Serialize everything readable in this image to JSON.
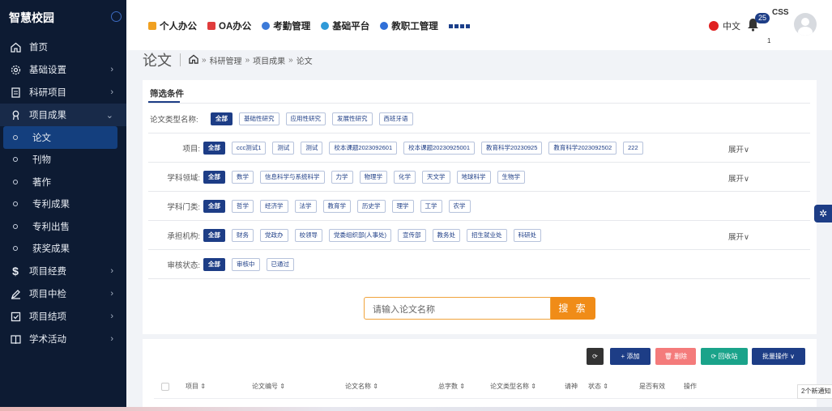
{
  "app": {
    "title": "智慧校园"
  },
  "sidebar": {
    "items": [
      {
        "label": "首页",
        "icon": "home-icon"
      },
      {
        "label": "基础设置",
        "icon": "gear-icon",
        "arrow": "›"
      },
      {
        "label": "科研项目",
        "icon": "document-icon",
        "arrow": "›"
      },
      {
        "label": "项目成果",
        "icon": "medal-icon",
        "arrow": "⌄"
      }
    ],
    "subitems": [
      {
        "label": "论文"
      },
      {
        "label": "刊物"
      },
      {
        "label": "著作"
      },
      {
        "label": "专利成果"
      },
      {
        "label": "专利出售"
      },
      {
        "label": "获奖成果"
      }
    ],
    "items2": [
      {
        "label": "项目经费",
        "icon": "dollar-icon",
        "arrow": "›"
      },
      {
        "label": "项目中检",
        "icon": "pen-icon",
        "arrow": "›"
      },
      {
        "label": "项目结项",
        "icon": "check-square-icon",
        "arrow": "›"
      },
      {
        "label": "学术活动",
        "icon": "book-icon",
        "arrow": "›"
      }
    ]
  },
  "topnav": {
    "items": [
      {
        "label": "个人办公",
        "color": "#f0a020"
      },
      {
        "label": "OA办公",
        "color": "#e03c3c"
      },
      {
        "label": "考勤管理",
        "color": "#3c7ad8"
      },
      {
        "label": "基础平台",
        "color": "#2f9ad8"
      },
      {
        "label": "教职工管理",
        "color": "#2f6fd8"
      }
    ],
    "lang": "中文",
    "notif_count": "25",
    "sub_count": "1",
    "user": "CSS"
  },
  "breadcrumb": {
    "title": "论文",
    "items": [
      "科研管理",
      "项目成果",
      "论文"
    ],
    "sep": "»"
  },
  "filter": {
    "title": "筛选条件",
    "expand": "展开∨",
    "rows": [
      {
        "label": "论文类型名称:",
        "chips": [
          "全部",
          "基础性研究",
          "应用性研究",
          "发展性研究",
          "西班牙语"
        ]
      },
      {
        "label": "项目:",
        "chips": [
          "全部",
          "ccc测试1",
          "测试",
          "测试",
          "校本课题2023092601",
          "校本课题20230925001",
          "教育科学20230925",
          "教育科学2023092502",
          "222"
        ]
      },
      {
        "label": "学科领域:",
        "chips": [
          "全部",
          "数学",
          "信息科学与系统科学",
          "力学",
          "物理学",
          "化学",
          "天文学",
          "地球科学",
          "生物学"
        ]
      },
      {
        "label": "学科门类:",
        "chips": [
          "全部",
          "哲学",
          "经济学",
          "法学",
          "教育学",
          "历史学",
          "理学",
          "工学",
          "农学"
        ]
      },
      {
        "label": "承担机构:",
        "chips": [
          "全部",
          "财务",
          "党政办",
          "校领导",
          "党委组织部(人事处)",
          "宣传部",
          "教务处",
          "招生就业处",
          "科研处"
        ]
      },
      {
        "label": "审核状态:",
        "chips": [
          "全部",
          "审核中",
          "已通过"
        ]
      }
    ]
  },
  "search": {
    "placeholder": "请输入论文名称",
    "button": "搜 索"
  },
  "toolbar": {
    "refresh": "⟳",
    "add": "+ 添加",
    "delete": "🗑 删除",
    "recycle": "⟳ 回收站",
    "batch": "批量操作 ∨",
    "colors": {
      "refresh": "#333333",
      "add": "#1d3d86",
      "delete": "#f47b7b",
      "recycle": "#1aa38a",
      "batch": "#1d3d86"
    }
  },
  "table": {
    "columns": [
      "项目 ⇕",
      "论文编号 ⇕",
      "论文名称 ⇕",
      "总字数 ⇕",
      "论文类型名称 ⇕",
      "请神",
      "状态 ⇕",
      "是否有效",
      "操作"
    ]
  },
  "notice": "2个新通知"
}
